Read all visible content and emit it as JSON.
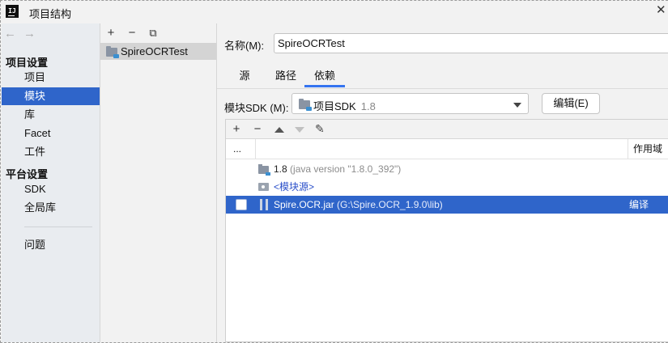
{
  "window": {
    "title": "项目结构",
    "app_icon_text": "IJ"
  },
  "nav": {
    "back_arrow": "←",
    "forward_arrow": "→",
    "sections": [
      {
        "title": "项目设置",
        "items": [
          "项目",
          "模块",
          "库",
          "Facet",
          "工件"
        ]
      },
      {
        "title": "平台设置",
        "items": [
          "SDK",
          "全局库"
        ]
      }
    ],
    "problems": "问题",
    "selected_item": "模块"
  },
  "modules": {
    "toolbar": {
      "add": "+",
      "remove": "−",
      "copy": "⧉"
    },
    "items": [
      "SpireOCRTest"
    ]
  },
  "main": {
    "name_label": "名称(M):",
    "name_value": "SpireOCRTest",
    "tabs": [
      "源",
      "路径",
      "依赖"
    ],
    "active_tab": "依赖",
    "sdk_label": "模块SDK (M):",
    "sdk_value": "项目SDK",
    "sdk_version": "1.8",
    "edit_button": "编辑(E)"
  },
  "dependencies": {
    "toolbar": {
      "add": "+",
      "remove": "−",
      "edit": "✎"
    },
    "header": {
      "col1": "...",
      "scope": "作用域"
    },
    "rows": [
      {
        "name": "1.8",
        "detail": "(java version \"1.8.0_392\")",
        "scope": "",
        "selected": false
      },
      {
        "name": "<模块源>",
        "detail": "",
        "scope": "",
        "selected": false
      },
      {
        "name": "Spire.OCR.jar",
        "detail": "(G:\\Spire.OCR_1.9.0\\lib)",
        "scope": "编译",
        "selected": true
      }
    ]
  },
  "colors": {
    "selection": "#2f65ca",
    "tab_underline": "#3574f0",
    "link": "#2a4fc9"
  }
}
